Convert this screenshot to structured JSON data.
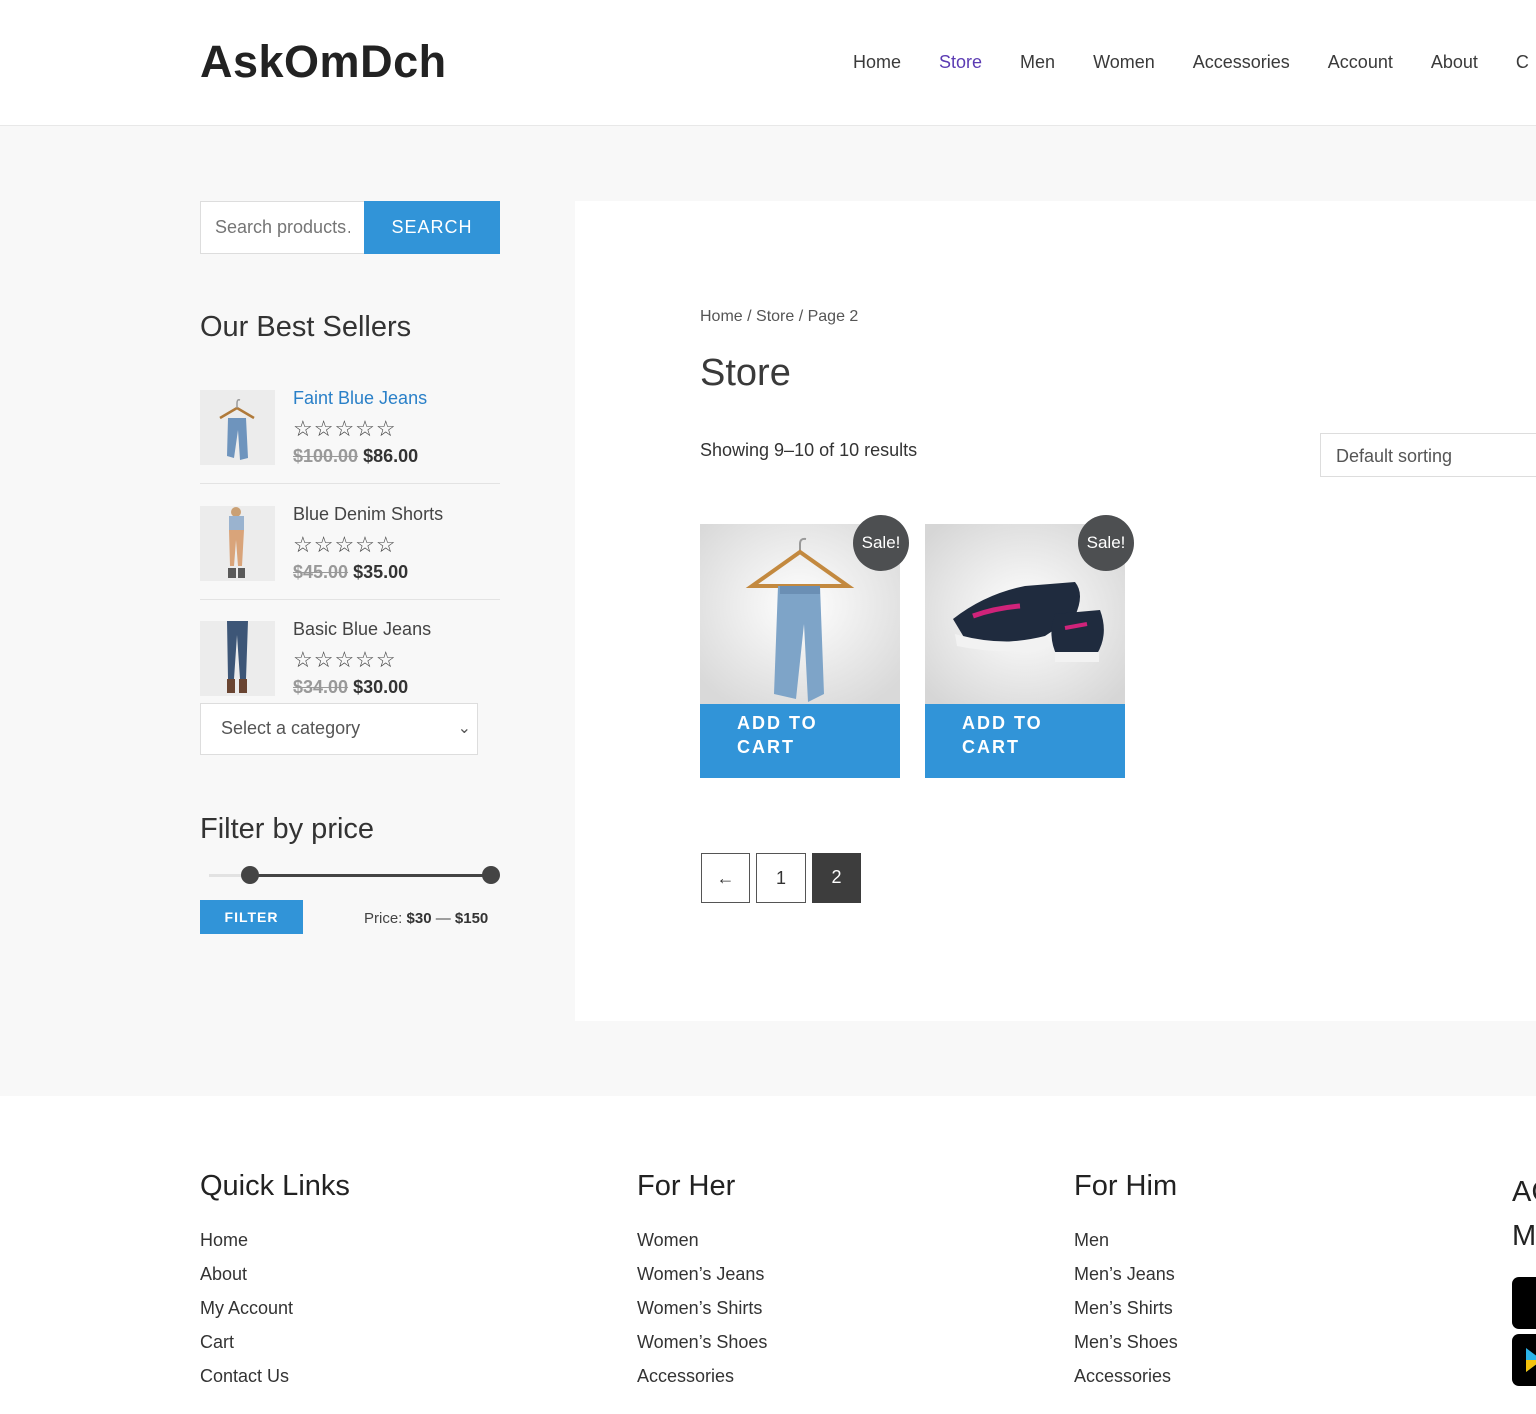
{
  "site": {
    "logo": "AskOmDch"
  },
  "nav": [
    {
      "label": "Home",
      "active": false
    },
    {
      "label": "Store",
      "active": true
    },
    {
      "label": "Men",
      "active": false
    },
    {
      "label": "Women",
      "active": false
    },
    {
      "label": "Accessories",
      "active": false
    },
    {
      "label": "Account",
      "active": false
    },
    {
      "label": "About",
      "active": false
    },
    {
      "label": "C",
      "active": false
    }
  ],
  "sidebar": {
    "search": {
      "placeholder": "Search products…",
      "button": "SEARCH"
    },
    "best_sellers": {
      "title": "Our Best Sellers",
      "items": [
        {
          "name": "Faint Blue Jeans",
          "old_price": "$100.00",
          "price": "$86.00",
          "rating_stars": "☆☆☆☆☆"
        },
        {
          "name": "Blue Denim Shorts",
          "old_price": "$45.00",
          "price": "$35.00",
          "rating_stars": "☆☆☆☆☆"
        },
        {
          "name": "Basic Blue Jeans",
          "old_price": "$34.00",
          "price": "$30.00",
          "rating_stars": "☆☆☆☆☆"
        }
      ]
    },
    "category_select": {
      "value": "Select a category"
    },
    "price_filter": {
      "title": "Filter by price",
      "button": "FILTER",
      "label": "Price:",
      "min": "$30",
      "dash": "—",
      "max": "$150",
      "range_fraction": [
        0.14,
        0.97
      ]
    }
  },
  "main": {
    "breadcrumb": "Home / Store / Page 2",
    "title": "Store",
    "result_count": "Showing 9–10 of 10 results",
    "sorting": "Default sorting",
    "products": [
      {
        "badge": "Sale!",
        "button": "ADD TO CART",
        "image": "jeans-on-hanger"
      },
      {
        "badge": "Sale!",
        "button": "ADD TO CART",
        "image": "sneakers"
      }
    ],
    "pagination": {
      "prev": "←",
      "pages": [
        "1",
        "2"
      ],
      "current": "2"
    }
  },
  "footer": {
    "quick_links": {
      "title": "Quick Links",
      "items": [
        "Home",
        "About",
        "My Account",
        "Cart",
        "Contact Us"
      ]
    },
    "for_her": {
      "title": "For Her",
      "items": [
        "Women",
        "Women’s Jeans",
        "Women’s Shirts",
        "Women’s Shoes",
        "Accessories"
      ]
    },
    "for_him": {
      "title": "For Him",
      "items": [
        "Men",
        "Men’s Jeans",
        "Men’s Shirts",
        "Men’s Shoes",
        "Accessories"
      ]
    },
    "apps": {
      "title_line1": "AC",
      "title_line2": "M"
    }
  },
  "colors": {
    "accent": "#3194d8",
    "nav_active": "#5b3bb3",
    "badge": "#4d4f51",
    "link": "#2a80c8"
  }
}
